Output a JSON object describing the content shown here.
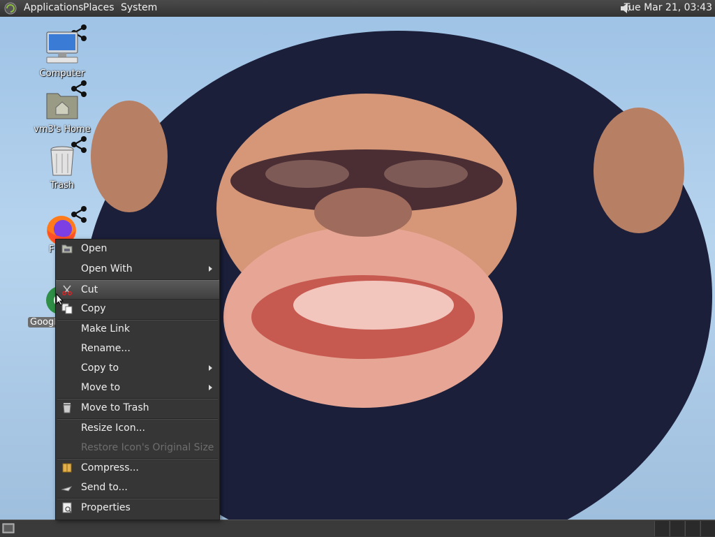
{
  "top_panel": {
    "menus": [
      "Applications",
      "Places",
      "System"
    ],
    "clock": "Tue Mar 21, 03:43",
    "volume_icon": "speaker-icon"
  },
  "desktop": {
    "wallpaper": "chimpanzee-face",
    "icons": [
      {
        "label": "Computer",
        "icon": "computer-icon"
      },
      {
        "label": "vm3's Home",
        "icon": "home-folder-icon"
      },
      {
        "label": "Trash",
        "icon": "trash-icon"
      },
      {
        "label": "F",
        "icon": "firefox-icon"
      },
      {
        "label": "Google",
        "icon": "chrome-icon"
      }
    ]
  },
  "context_menu": {
    "items": [
      {
        "label": "Open",
        "icon": "folder-open-icon"
      },
      {
        "label": "Open With",
        "submenu": true
      },
      {
        "label": "Cut",
        "icon": "scissors-icon",
        "highlighted": true
      },
      {
        "label": "Copy",
        "icon": "copy-icon"
      },
      {
        "label": "Make Link"
      },
      {
        "label": "Rename..."
      },
      {
        "label": "Copy to",
        "submenu": true
      },
      {
        "label": "Move to",
        "submenu": true
      },
      {
        "label": "Move to Trash",
        "icon": "trash-icon"
      },
      {
        "label": "Resize Icon..."
      },
      {
        "label": "Restore Icon's Original Size",
        "disabled": true
      },
      {
        "label": "Compress...",
        "icon": "archive-icon"
      },
      {
        "label": "Send to...",
        "icon": "send-icon"
      },
      {
        "label": "Properties",
        "icon": "properties-icon"
      }
    ]
  }
}
